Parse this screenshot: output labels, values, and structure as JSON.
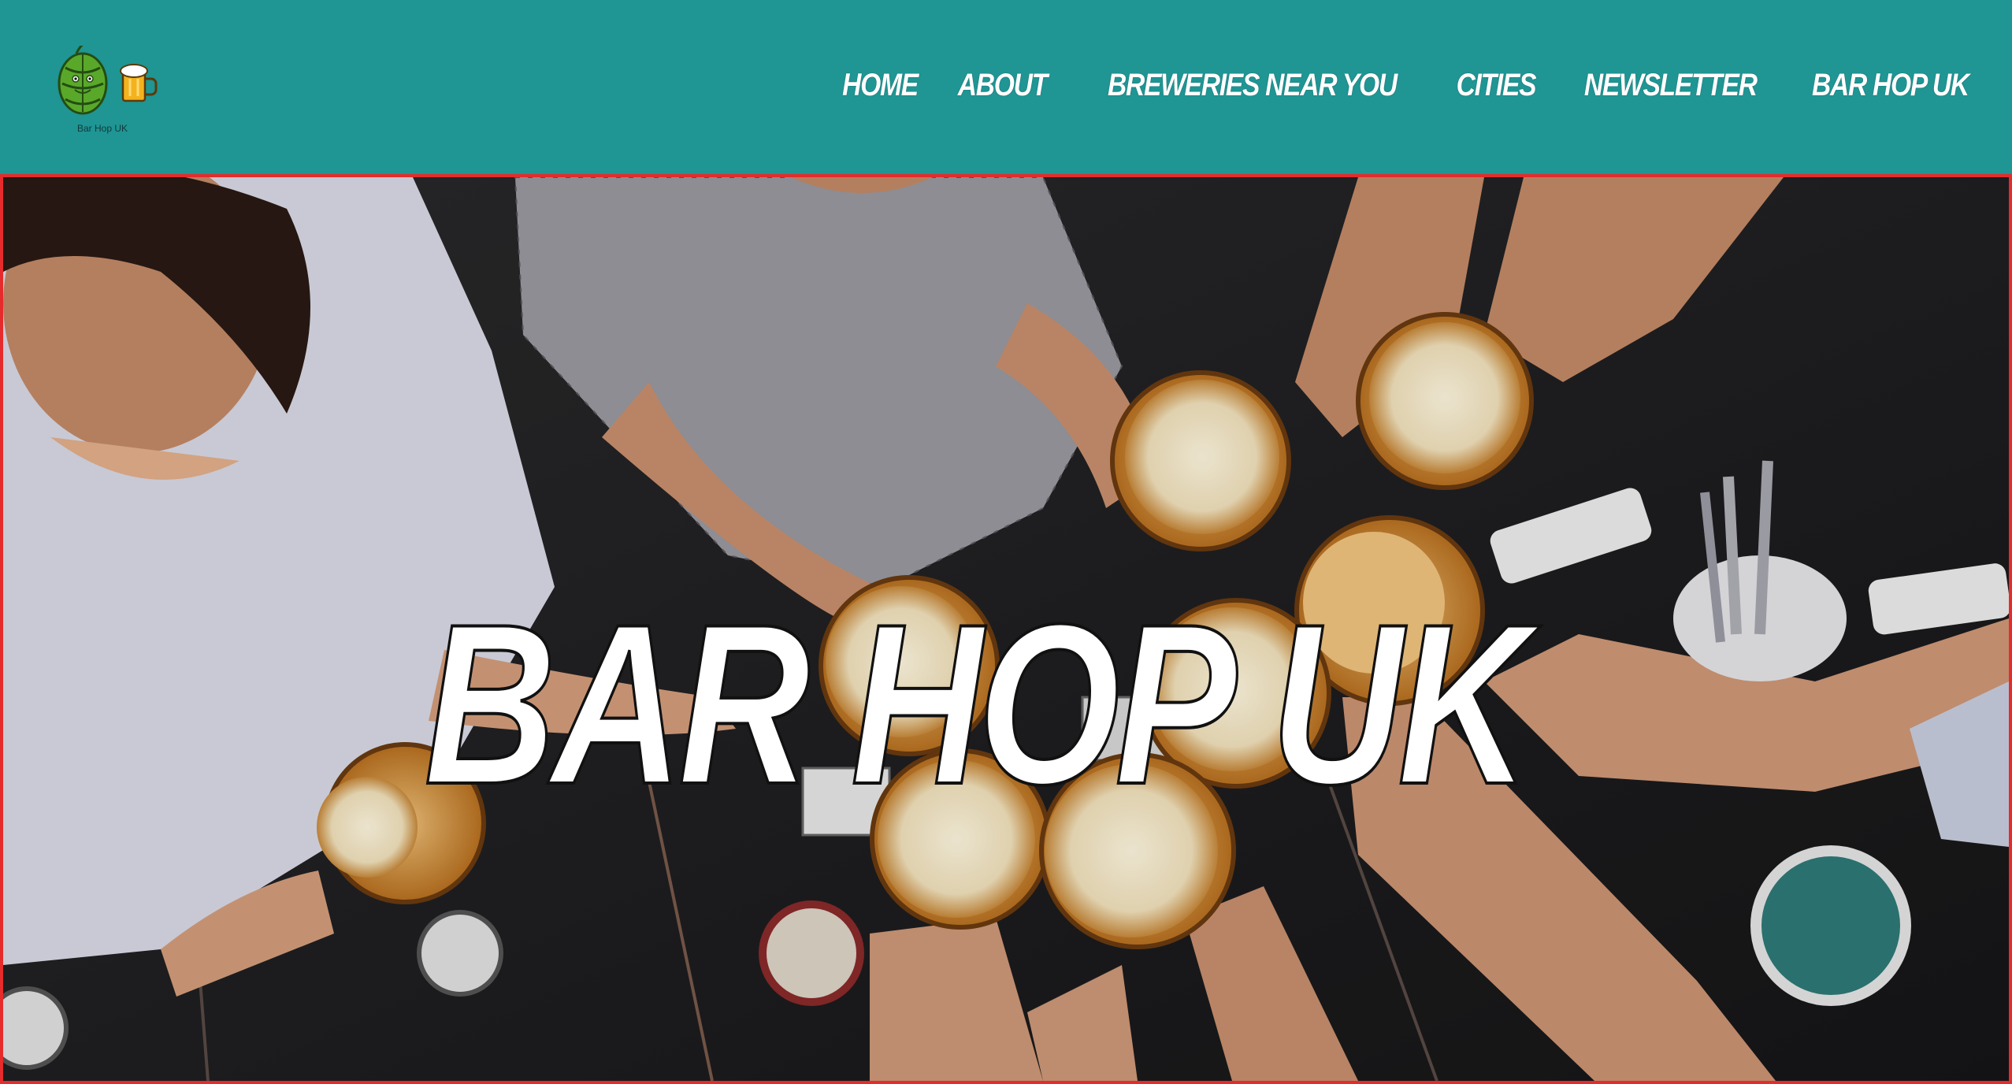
{
  "site": {
    "logo_text": "Bar Hop UK",
    "logo_icons": [
      "hop-icon",
      "beer-mug-icon"
    ]
  },
  "nav": {
    "items": [
      {
        "label": "Home"
      },
      {
        "label": "About"
      },
      {
        "label": "Breweries Near You"
      },
      {
        "label": "Cities"
      },
      {
        "label": "Newsletter"
      },
      {
        "label": "Bar Hop UK"
      }
    ]
  },
  "hero": {
    "title": "BAR HOP UK",
    "image": "friends-toasting-beer-mugs-photo"
  },
  "colors": {
    "header_bg": "#1f9594",
    "hero_border": "#e52b2b",
    "nav_text": "#ffffff",
    "title_text": "#ffffff"
  }
}
